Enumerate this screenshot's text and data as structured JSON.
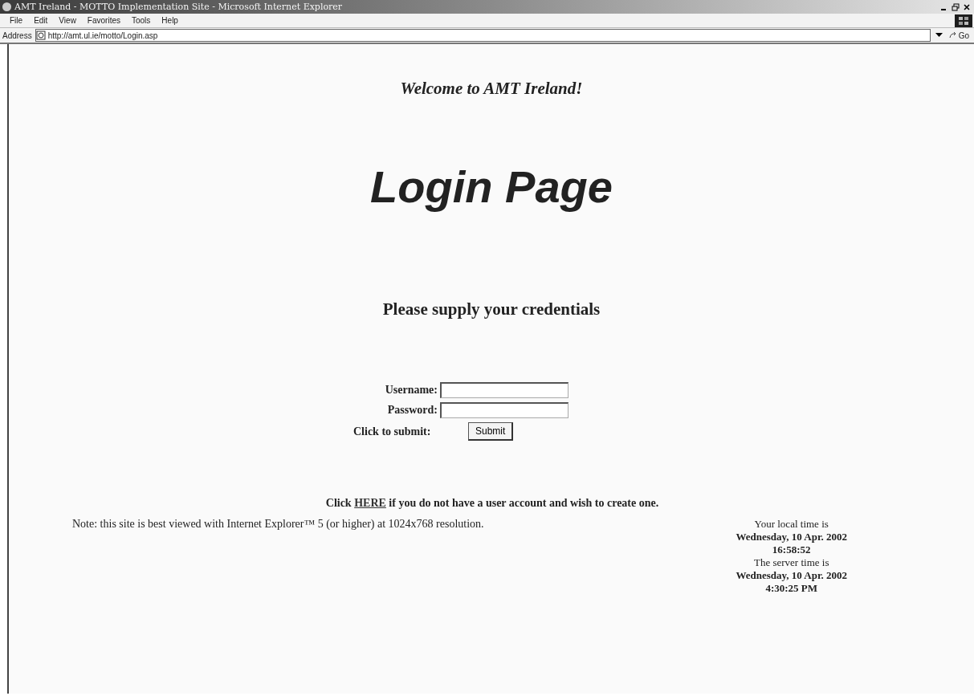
{
  "window": {
    "title": "AMT Ireland - MOTTO Implementation Site - Microsoft Internet Explorer"
  },
  "menu": [
    "File",
    "Edit",
    "View",
    "Favorites",
    "Tools",
    "Help"
  ],
  "address": {
    "label": "Address",
    "value": "http://amt.ul.ie/motto/Login.asp",
    "go": "Go"
  },
  "page": {
    "welcome": "Welcome to AMT Ireland!",
    "heading": "Login Page",
    "prompt": "Please supply your credentials",
    "fields": [
      {
        "label": "Username:"
      },
      {
        "label": "Password:"
      }
    ],
    "submit_label": "Click to submit:",
    "submit": "Submit",
    "signup": {
      "before": "Click ",
      "link": "HERE",
      "after": " if you do not have a user account and wish to create one."
    },
    "note": "Note: this site is best viewed with Internet Explorer™ 5 (or higher) at 1024x768 resolution.",
    "times": [
      "Your local time is",
      "Wednesday, 10 Apr. 2002",
      "16:58:52",
      "The server time is",
      "Wednesday, 10 Apr. 2002",
      "4:30:25 PM"
    ]
  }
}
